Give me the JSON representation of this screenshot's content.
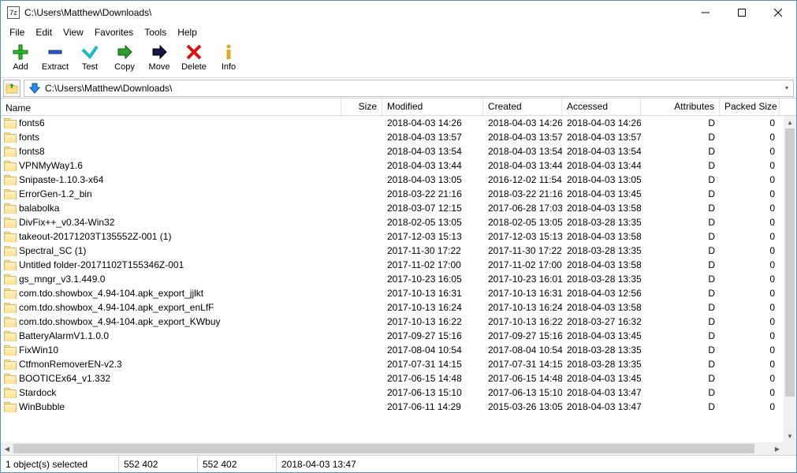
{
  "window": {
    "title": "C:\\Users\\Matthew\\Downloads\\",
    "appicon_text": "7z"
  },
  "menu": [
    "File",
    "Edit",
    "View",
    "Favorites",
    "Tools",
    "Help"
  ],
  "toolbar": [
    {
      "id": "add",
      "label": "Add"
    },
    {
      "id": "extract",
      "label": "Extract"
    },
    {
      "id": "test",
      "label": "Test"
    },
    {
      "id": "copy",
      "label": "Copy"
    },
    {
      "id": "move",
      "label": "Move"
    },
    {
      "id": "delete",
      "label": "Delete"
    },
    {
      "id": "info",
      "label": "Info"
    }
  ],
  "address": {
    "path": "C:\\Users\\Matthew\\Downloads\\"
  },
  "columns": {
    "name": "Name",
    "size": "Size",
    "modified": "Modified",
    "created": "Created",
    "accessed": "Accessed",
    "attributes": "Attributes",
    "packed": "Packed Size"
  },
  "rows": [
    {
      "name": "fonts6",
      "size": "",
      "modified": "2018-04-03 14:26",
      "created": "2018-04-03 14:26",
      "accessed": "2018-04-03 14:26",
      "attr": "D",
      "packed": "0"
    },
    {
      "name": "fonts",
      "size": "",
      "modified": "2018-04-03 13:57",
      "created": "2018-04-03 13:57",
      "accessed": "2018-04-03 13:57",
      "attr": "D",
      "packed": "0"
    },
    {
      "name": "fonts8",
      "size": "",
      "modified": "2018-04-03 13:54",
      "created": "2018-04-03 13:54",
      "accessed": "2018-04-03 13:54",
      "attr": "D",
      "packed": "0"
    },
    {
      "name": "VPNMyWay1.6",
      "size": "",
      "modified": "2018-04-03 13:44",
      "created": "2018-04-03 13:44",
      "accessed": "2018-04-03 13:44",
      "attr": "D",
      "packed": "0"
    },
    {
      "name": "Snipaste-1.10.3-x64",
      "size": "",
      "modified": "2018-04-03 13:05",
      "created": "2016-12-02 11:54",
      "accessed": "2018-04-03 13:05",
      "attr": "D",
      "packed": "0"
    },
    {
      "name": "ErrorGen-1.2_bin",
      "size": "",
      "modified": "2018-03-22 21:16",
      "created": "2018-03-22 21:16",
      "accessed": "2018-04-03 13:45",
      "attr": "D",
      "packed": "0"
    },
    {
      "name": "balabolka",
      "size": "",
      "modified": "2018-03-07 12:15",
      "created": "2017-06-28 17:03",
      "accessed": "2018-04-03 13:58",
      "attr": "D",
      "packed": "0"
    },
    {
      "name": "DivFix++_v0.34-Win32",
      "size": "",
      "modified": "2018-02-05 13:05",
      "created": "2018-02-05 13:05",
      "accessed": "2018-03-28 13:35",
      "attr": "D",
      "packed": "0"
    },
    {
      "name": "takeout-20171203T135552Z-001 (1)",
      "size": "",
      "modified": "2017-12-03 15:13",
      "created": "2017-12-03 15:13",
      "accessed": "2018-04-03 13:58",
      "attr": "D",
      "packed": "0"
    },
    {
      "name": "Spectral_SC (1)",
      "size": "",
      "modified": "2017-11-30 17:22",
      "created": "2017-11-30 17:22",
      "accessed": "2018-03-28 13:35",
      "attr": "D",
      "packed": "0"
    },
    {
      "name": "Untitled folder-20171102T155346Z-001",
      "size": "",
      "modified": "2017-11-02 17:00",
      "created": "2017-11-02 17:00",
      "accessed": "2018-04-03 13:58",
      "attr": "D",
      "packed": "0"
    },
    {
      "name": "gs_mngr_v3.1.449.0",
      "size": "",
      "modified": "2017-10-23 16:05",
      "created": "2017-10-23 16:01",
      "accessed": "2018-03-28 13:35",
      "attr": "D",
      "packed": "0"
    },
    {
      "name": "com.tdo.showbox_4.94-104.apk_export_jjlkt",
      "size": "",
      "modified": "2017-10-13 16:31",
      "created": "2017-10-13 16:31",
      "accessed": "2018-04-03 12:56",
      "attr": "D",
      "packed": "0"
    },
    {
      "name": "com.tdo.showbox_4.94-104.apk_export_enLfF",
      "size": "",
      "modified": "2017-10-13 16:24",
      "created": "2017-10-13 16:24",
      "accessed": "2018-04-03 13:58",
      "attr": "D",
      "packed": "0"
    },
    {
      "name": "com.tdo.showbox_4.94-104.apk_export_KWbuy",
      "size": "",
      "modified": "2017-10-13 16:22",
      "created": "2017-10-13 16:22",
      "accessed": "2018-03-27 16:32",
      "attr": "D",
      "packed": "0"
    },
    {
      "name": "BatteryAlarmV1.1.0.0",
      "size": "",
      "modified": "2017-09-27 15:16",
      "created": "2017-09-27 15:16",
      "accessed": "2018-04-03 13:45",
      "attr": "D",
      "packed": "0"
    },
    {
      "name": "FixWin10",
      "size": "",
      "modified": "2017-08-04 10:54",
      "created": "2017-08-04 10:54",
      "accessed": "2018-03-28 13:35",
      "attr": "D",
      "packed": "0"
    },
    {
      "name": "CtfmonRemoverEN-v2.3",
      "size": "",
      "modified": "2017-07-31 14:15",
      "created": "2017-07-31 14:15",
      "accessed": "2018-03-28 13:35",
      "attr": "D",
      "packed": "0"
    },
    {
      "name": "BOOTICEx64_v1.332",
      "size": "",
      "modified": "2017-06-15 14:48",
      "created": "2017-06-15 14:48",
      "accessed": "2018-04-03 13:45",
      "attr": "D",
      "packed": "0"
    },
    {
      "name": "Stardock",
      "size": "",
      "modified": "2017-06-13 15:10",
      "created": "2017-06-13 15:10",
      "accessed": "2018-04-03 13:47",
      "attr": "D",
      "packed": "0"
    },
    {
      "name": "WinBubble",
      "size": "",
      "modified": "2017-06-11 14:29",
      "created": "2015-03-26 13:05",
      "accessed": "2018-04-03 13:47",
      "attr": "D",
      "packed": "0"
    }
  ],
  "status": {
    "selection": "1 object(s) selected",
    "s1": "552 402",
    "s2": "552 402",
    "s3": "2018-04-03 13:47"
  }
}
